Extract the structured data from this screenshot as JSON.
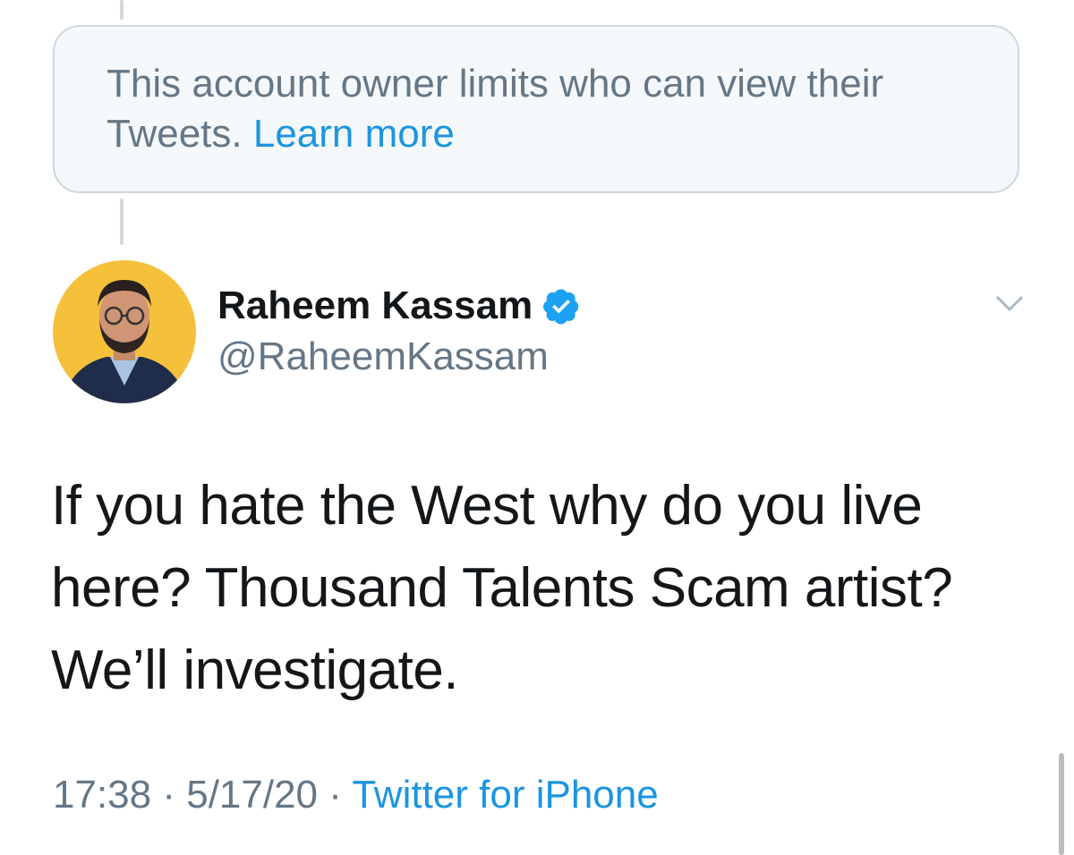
{
  "notice": {
    "text": "This account owner limits who can view their Tweets.",
    "link_label": "Learn more"
  },
  "author": {
    "display_name": "Raheem Kassam",
    "handle": "@RaheemKassam",
    "verified": true
  },
  "tweet": {
    "text": "If you hate the West why do you live here? Thousand Talents Scam artist? We’ll investigate."
  },
  "meta": {
    "time": "17:38",
    "separator": " · ",
    "date": "5/17/20",
    "source": "Twitter for iPhone"
  },
  "colors": {
    "link": "#1b95e0",
    "secondary_text": "#657786",
    "primary_text": "#14171a",
    "avatar_background": "#f5c03a"
  }
}
